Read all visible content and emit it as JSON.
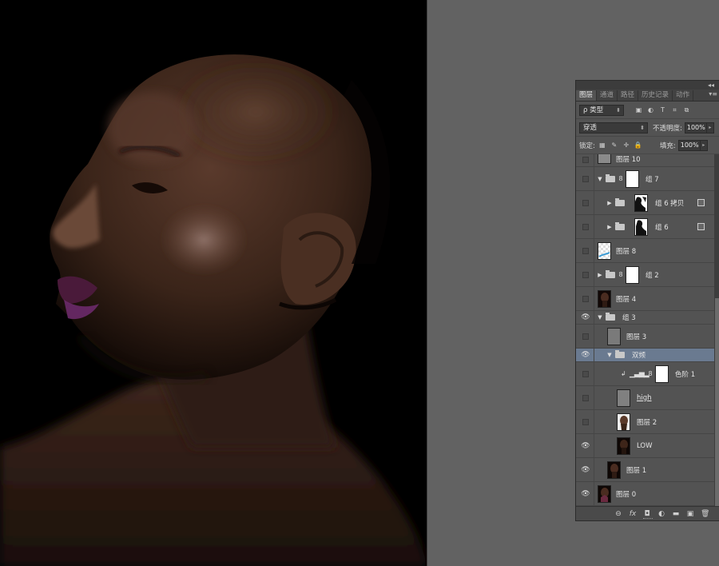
{
  "panel": {
    "tabs": [
      {
        "label": "图层"
      },
      {
        "label": "通道"
      },
      {
        "label": "路径"
      },
      {
        "label": "历史记录"
      },
      {
        "label": "动作"
      }
    ],
    "filter_select": "ρ 类型",
    "blend_mode": "穿透",
    "opacity_label": "不透明度:",
    "opacity_value": "100%",
    "lock_label": "锁定:",
    "fill_label": "填充:",
    "fill_value": "100%"
  },
  "layers": [
    {
      "name": "图层 10",
      "visible": false,
      "kind": "pixel"
    },
    {
      "name": "组 7",
      "visible": false,
      "kind": "group-mask",
      "expanded": true
    },
    {
      "name": "组 6 拷贝",
      "visible": false,
      "kind": "group-mask-child",
      "expanded": false
    },
    {
      "name": "组 6",
      "visible": false,
      "kind": "group-mask-child",
      "expanded": false
    },
    {
      "name": "图层 8",
      "visible": false,
      "kind": "pixel"
    },
    {
      "name": "组 2",
      "visible": false,
      "kind": "group-mask",
      "expanded": false
    },
    {
      "name": "图层 4",
      "visible": false,
      "kind": "pixel"
    },
    {
      "name": "组 3",
      "visible": true,
      "kind": "group",
      "expanded": true
    },
    {
      "name": "图层 3",
      "visible": false,
      "kind": "pixel"
    },
    {
      "name": "双频",
      "visible": true,
      "kind": "group",
      "expanded": true,
      "selected": true
    },
    {
      "name": "色阶 1",
      "visible": false,
      "kind": "adjustment"
    },
    {
      "name": "high",
      "visible": false,
      "kind": "pixel"
    },
    {
      "name": "图层 2",
      "visible": false,
      "kind": "pixel"
    },
    {
      "name": "LOW",
      "visible": true,
      "kind": "pixel"
    },
    {
      "name": "图层 1",
      "visible": true,
      "kind": "pixel"
    },
    {
      "name": "图层 0",
      "visible": true,
      "kind": "pixel"
    }
  ],
  "icons": {
    "eye": "eye-icon",
    "folder": "folder-icon",
    "link": "link-icon",
    "fx": "fx-icon",
    "mask": "add-mask-icon",
    "adjustment": "adjustment-icon",
    "new_group": "new-group-icon",
    "new_layer": "new-layer-icon",
    "delete": "trash-icon"
  },
  "footer": {
    "link": "⊖",
    "fx": "fx",
    "mask": "◘",
    "adjust": "◐",
    "group": "▬",
    "new": "▣",
    "delete": "🗑"
  }
}
